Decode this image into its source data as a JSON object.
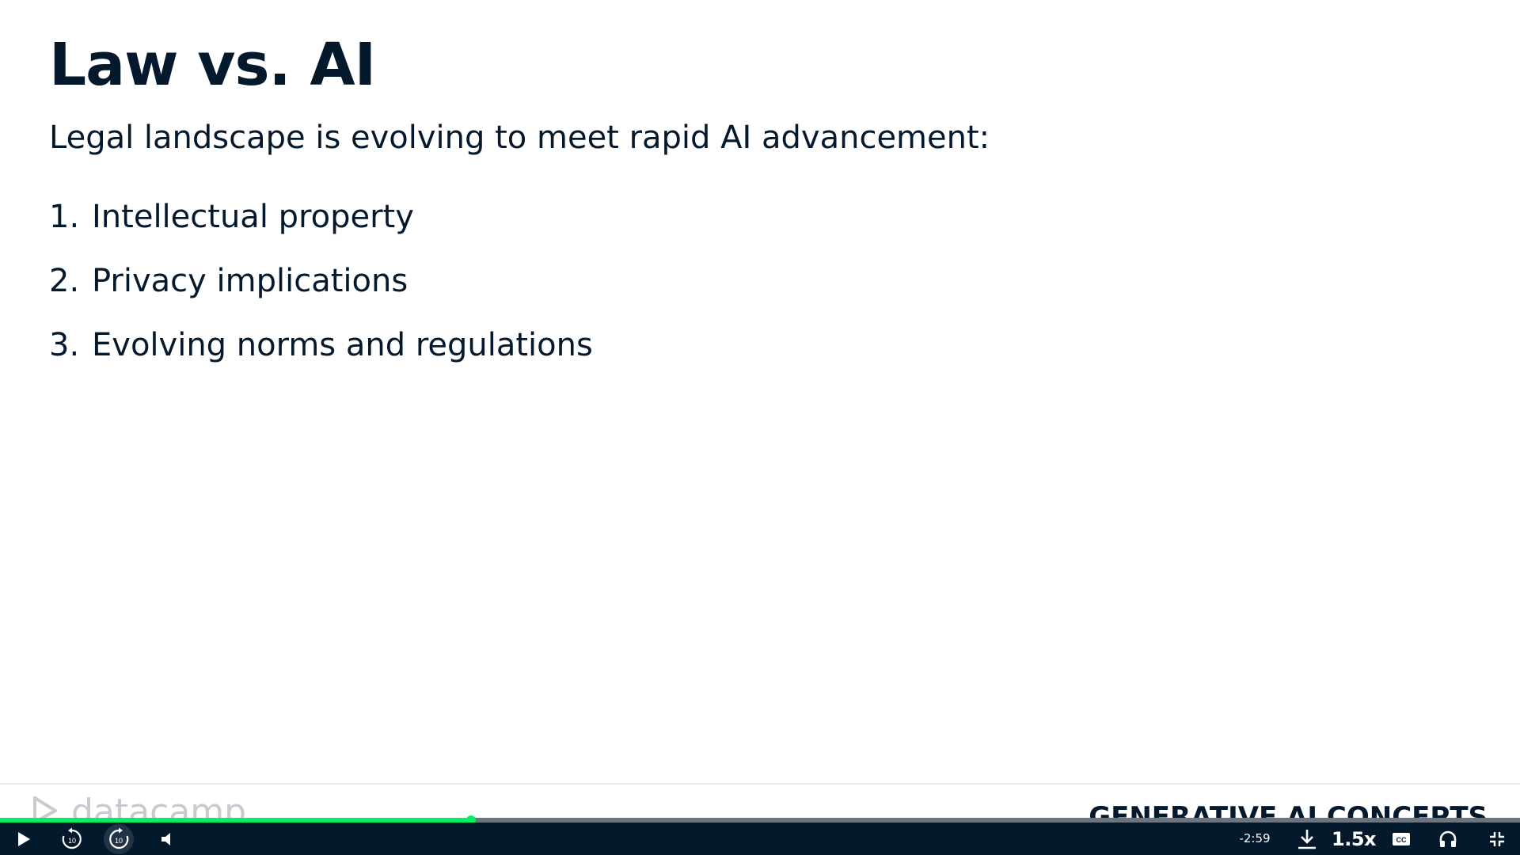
{
  "slide": {
    "title": "Law vs. AI",
    "subtitle": "Legal landscape is evolving to meet rapid AI advancement:",
    "items": [
      {
        "number": "1.",
        "text": "Intellectual property"
      },
      {
        "number": "2.",
        "text": "Privacy implications"
      },
      {
        "number": "3.",
        "text": "Evolving norms and regulations"
      }
    ],
    "footer": {
      "logo_text": "datacamp",
      "course_name": "GENERATIVE AI CONCEPTS"
    }
  },
  "player": {
    "progress_fraction": 0.31,
    "time_remaining": "-2:59",
    "playback_speed": "1.5x",
    "controls": {
      "play": "play-icon",
      "rewind": "rewind-10-icon",
      "forward": "forward-10-icon",
      "volume": "volume-icon",
      "download": "download-icon",
      "captions": "closed-captions-icon",
      "audio": "headphones-icon",
      "exit_fullscreen": "exit-fullscreen-icon"
    },
    "colors": {
      "accent": "#03ef62",
      "control_bar": "#05192d",
      "track": "#6c7480",
      "text": "#05192d"
    }
  }
}
